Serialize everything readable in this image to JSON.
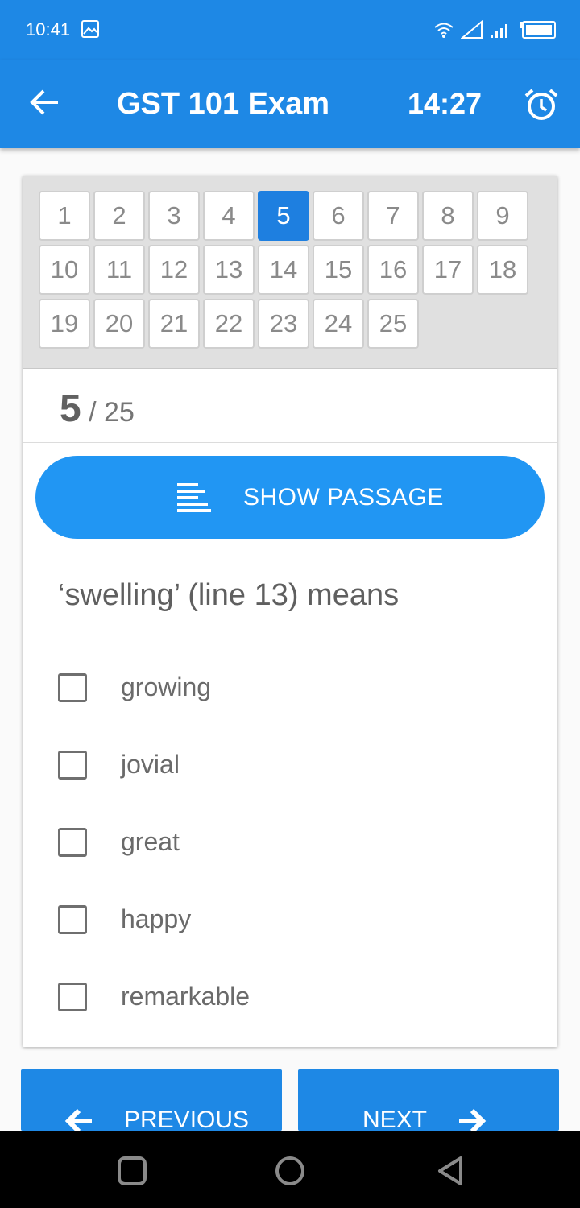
{
  "status_bar": {
    "time": "10:41"
  },
  "app_bar": {
    "title": "GST 101 Exam",
    "timer": "14:27"
  },
  "question_grid": {
    "numbers": [
      "1",
      "2",
      "3",
      "4",
      "5",
      "6",
      "7",
      "8",
      "9",
      "10",
      "11",
      "12",
      "13",
      "14",
      "15",
      "16",
      "17",
      "18",
      "19",
      "20",
      "21",
      "22",
      "23",
      "24",
      "25"
    ],
    "current": 5
  },
  "counter": {
    "current": "5",
    "separator": " / ",
    "total": "25"
  },
  "passage_button": {
    "label": "SHOW PASSAGE"
  },
  "question": {
    "text": "‘swelling’ (line 13) means"
  },
  "options": [
    {
      "label": "growing",
      "checked": false
    },
    {
      "label": "jovial",
      "checked": false
    },
    {
      "label": "great",
      "checked": false
    },
    {
      "label": "happy",
      "checked": false
    },
    {
      "label": "remarkable",
      "checked": false
    }
  ],
  "navigation": {
    "previous_label": "PREVIOUS",
    "next_label": "NEXT"
  },
  "colors": {
    "primary": "#1e88e5",
    "button": "#2196f3",
    "active_tile": "#1e7fe0"
  }
}
